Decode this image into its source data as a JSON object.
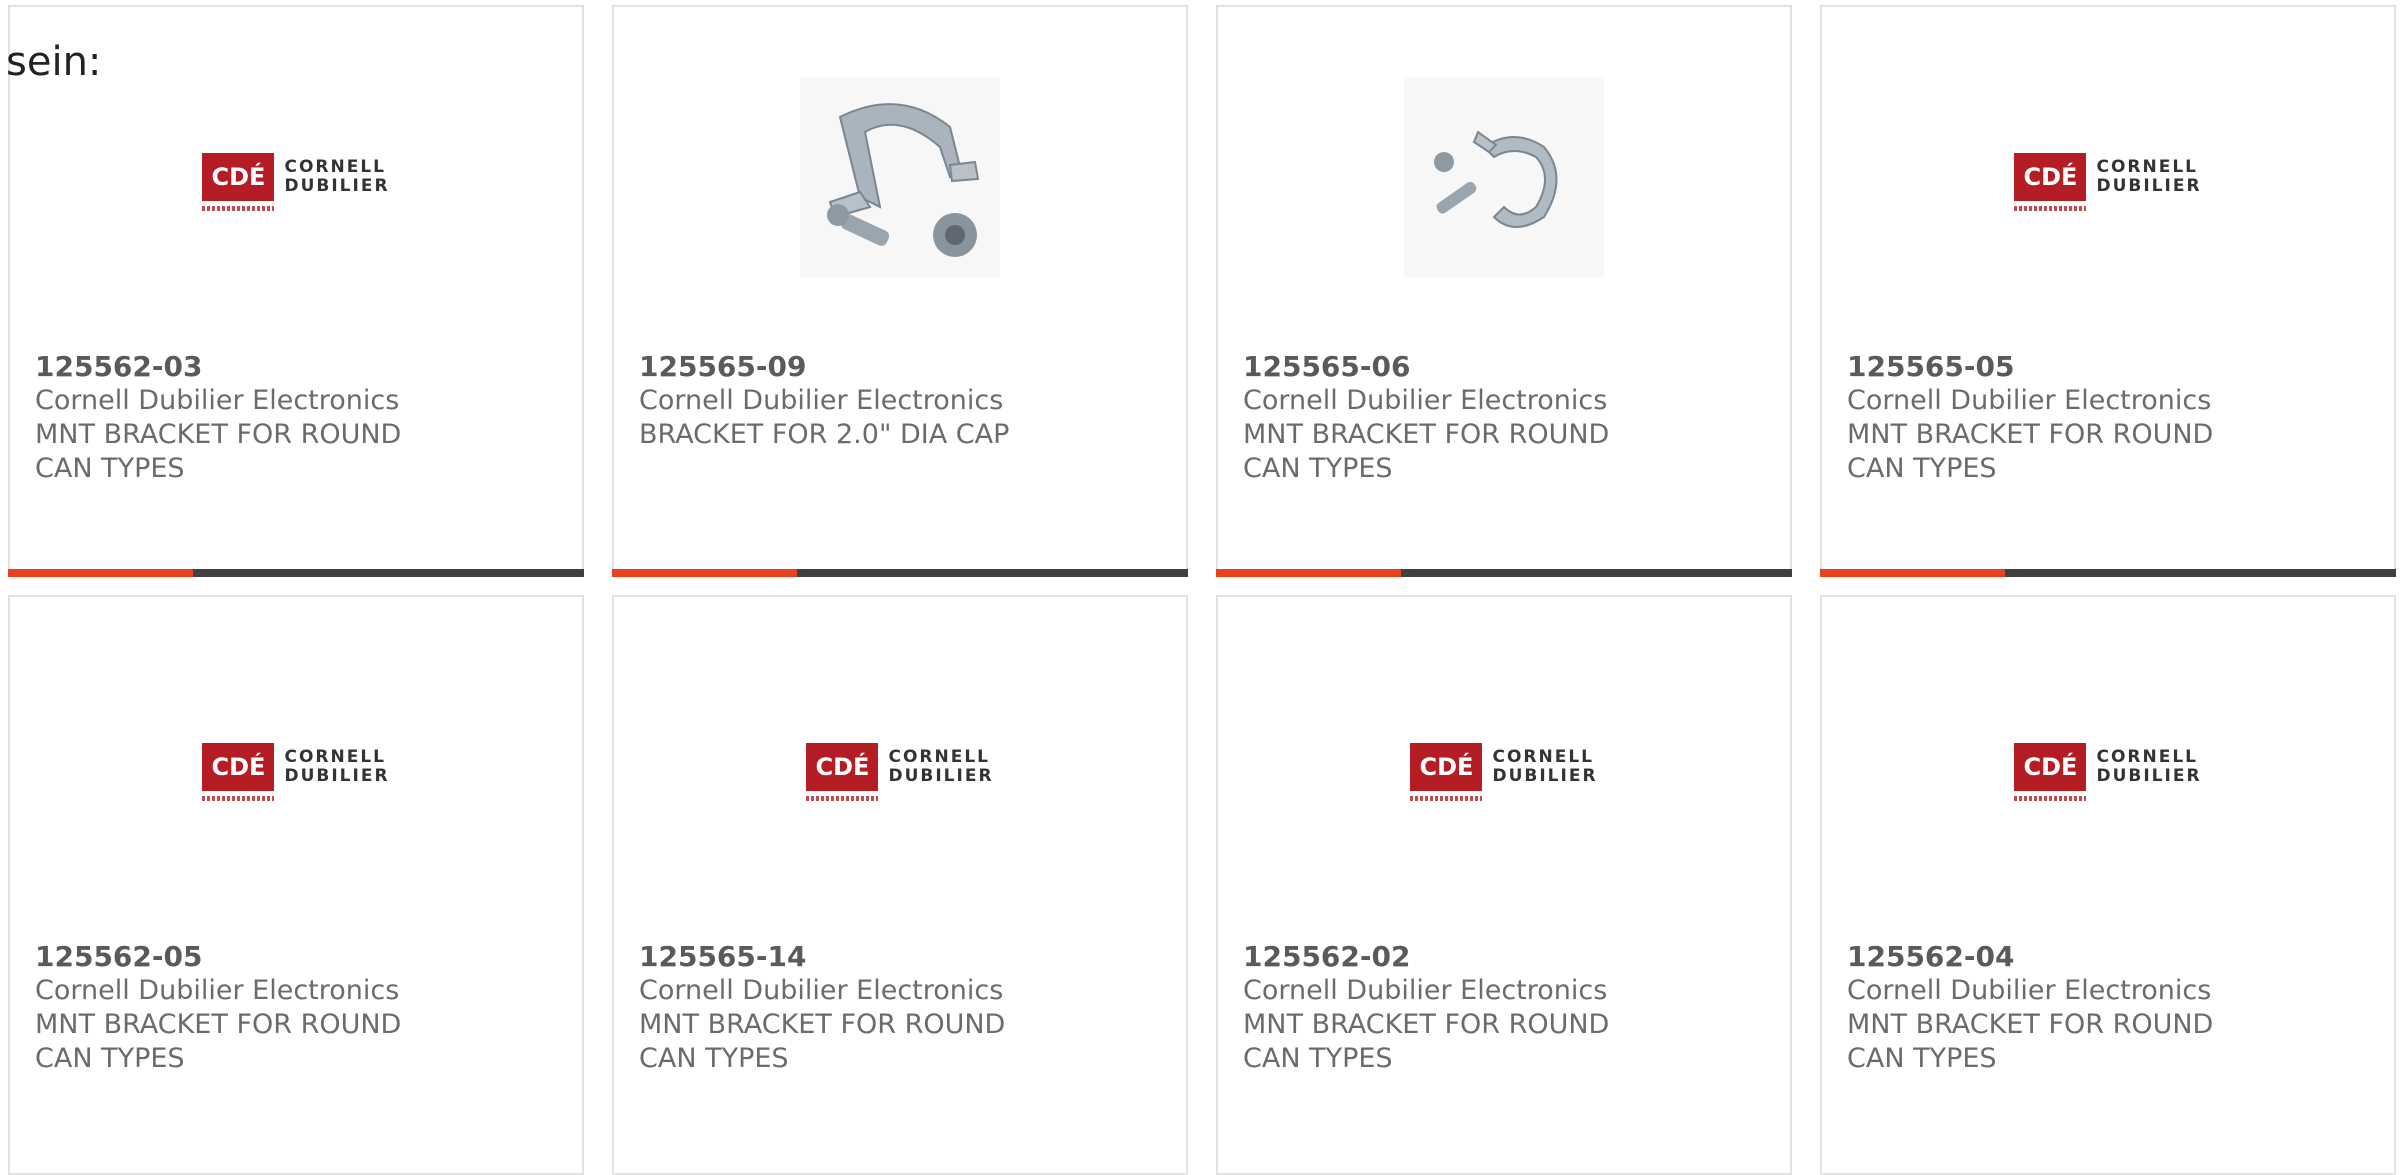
{
  "intro_text": "sein:",
  "colors": {
    "accent": "#e8421a",
    "bar": "#404040",
    "border": "#e2e2e2",
    "logo_red": "#b51d24"
  },
  "logo": {
    "mark": "CDÉ",
    "line1": "CORNELL",
    "line2": "DUBILIER"
  },
  "products": [
    {
      "part_number": "125562-03",
      "manufacturer": "Cornell Dubilier Electronics",
      "description": "MNT BRACKET FOR ROUND CAN TYPES",
      "image": "cde-logo"
    },
    {
      "part_number": "125565-09",
      "manufacturer": "Cornell Dubilier Electronics",
      "description": "BRACKET FOR 2.0\" DIA CAP",
      "image": "bracket-photo"
    },
    {
      "part_number": "125565-06",
      "manufacturer": "Cornell Dubilier Electronics",
      "description": "MNT BRACKET FOR ROUND CAN TYPES",
      "image": "clamp-photo"
    },
    {
      "part_number": "125565-05",
      "manufacturer": "Cornell Dubilier Electronics",
      "description": "MNT BRACKET FOR ROUND CAN TYPES",
      "image": "cde-logo"
    },
    {
      "part_number": "125562-05",
      "manufacturer": "Cornell Dubilier Electronics",
      "description": "MNT BRACKET FOR ROUND CAN TYPES",
      "image": "cde-logo"
    },
    {
      "part_number": "125565-14",
      "manufacturer": "Cornell Dubilier Electronics",
      "description": "MNT BRACKET FOR ROUND CAN TYPES",
      "image": "cde-logo"
    },
    {
      "part_number": "125562-02",
      "manufacturer": "Cornell Dubilier Electronics",
      "description": "MNT BRACKET FOR ROUND CAN TYPES",
      "image": "cde-logo"
    },
    {
      "part_number": "125562-04",
      "manufacturer": "Cornell Dubilier Electronics",
      "description": "MNT BRACKET FOR ROUND CAN TYPES",
      "image": "cde-logo"
    }
  ]
}
